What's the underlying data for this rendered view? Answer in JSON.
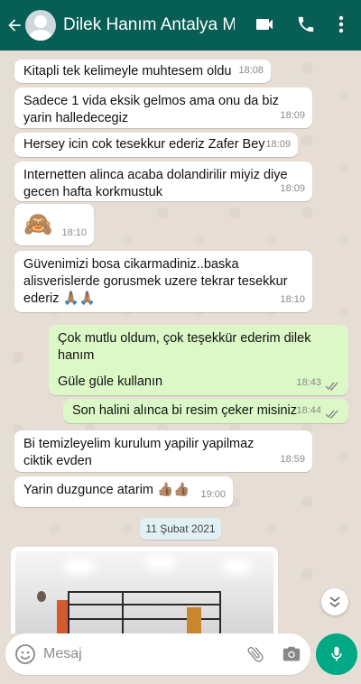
{
  "header": {
    "title": "Dilek Hanım Antalya M...",
    "icons": [
      "back-arrow-icon",
      "avatar",
      "video-call-icon",
      "phone-icon",
      "more-vert-icon"
    ]
  },
  "messages": [
    {
      "dir": "in",
      "text": "Kitapli tek kelimeyle muhtesem oldu",
      "time": "18:08"
    },
    {
      "dir": "in",
      "text": "Sadece 1 vida eksik gelmos ama onu da biz yarin halledecegiz",
      "time": "18:09"
    },
    {
      "dir": "in",
      "text": "Hersey icin cok tesekkur ederiz Zafer Bey",
      "time": "18:09"
    },
    {
      "dir": "in",
      "text": "Internetten alinca acaba dolandirilir miyiz diye gecen hafta korkmustuk",
      "time": "18:09"
    },
    {
      "dir": "in",
      "text": "🙈",
      "time": "18:10"
    },
    {
      "dir": "in",
      "text": "Güvenimizi bosa cikarmadiniz..baska alisverislerde gorusmek uzere tekrar tesekkur ederiz 🙏🏽🙏🏽",
      "time": "18:10"
    },
    {
      "dir": "out",
      "text": "Çok mutlu oldum, çok teşekkür ederim dilek hanım",
      "text2": "Güle güle kullanın",
      "time": "18:43"
    },
    {
      "dir": "out",
      "text": "Son halini alınca bi resim çeker misiniz",
      "time": "18:44"
    },
    {
      "dir": "in",
      "text": "Bi temizleyelim kurulum yapilir yapilmaz ciktik evden",
      "time": "18:59"
    },
    {
      "dir": "in",
      "text": "Yarin duzgunce atarim 👍🏽👍🏽",
      "time": "19:00"
    }
  ],
  "date_separator": "11 Şubat 2021",
  "input": {
    "placeholder": "Mesaj"
  },
  "colors": {
    "header": "#075e54",
    "outgoing": "#dcf8c6",
    "incoming": "#ffffff",
    "mic": "#00a884",
    "ticks": "#8a8a8a"
  }
}
